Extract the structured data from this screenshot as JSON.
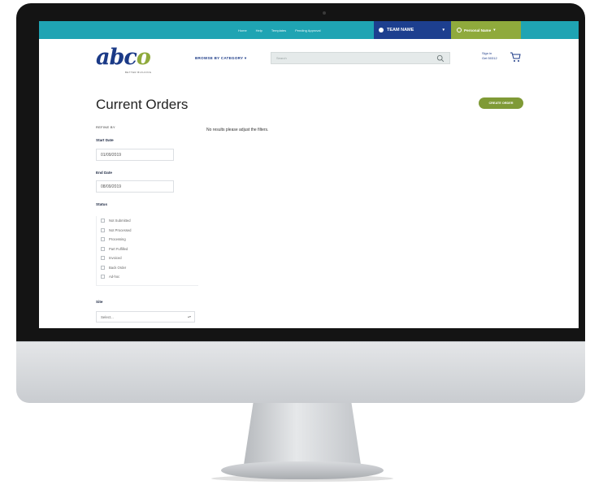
{
  "topbar": {
    "links": [
      "Home",
      "Help",
      "Templates",
      "Pending Approval"
    ],
    "team_name": "TEAM NAME",
    "personal_name": "Personal Name"
  },
  "header": {
    "logo": "abco",
    "tagline": "BETTER BUILDING",
    "browse_label": "BROWSE BY CATEGORY",
    "search_placeholder": "Search",
    "signin_line1": "Sign in",
    "signin_line2": "Get 50312"
  },
  "main": {
    "title": "Current Orders",
    "create_button": "CREATE ORDER",
    "refine_by": "REFINE BY",
    "no_results": "No results please adjust the filters.",
    "start_date_label": "Start Date",
    "start_date_value": "01/09/2019",
    "end_date_label": "End Date",
    "end_date_value": "08/09/2019",
    "status_label": "Status",
    "statuses": [
      "Not Submitted",
      "Not Processed",
      "Processing",
      "Part Fulfilled",
      "Invoiced",
      "Back Order",
      "Ad-hoc"
    ],
    "site_label": "Site",
    "site_value": "Select..."
  },
  "colors": {
    "topbar": "#1fa4b3",
    "team": "#1d3f8f",
    "personal": "#8faa3c",
    "brand_blue": "#1b3a87",
    "brand_green": "#7f9a36"
  }
}
